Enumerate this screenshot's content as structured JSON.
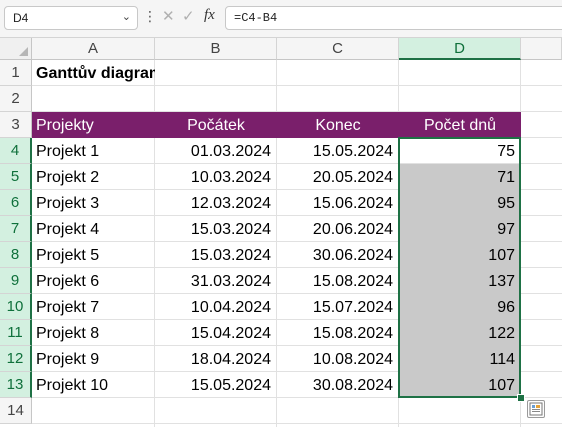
{
  "formula_bar": {
    "name_box": "D4",
    "formula": "=C4-B4",
    "more_icon": "vertical-ellipsis",
    "cancel_icon": "x-mark",
    "enter_icon": "check-mark",
    "fx_label": "fx"
  },
  "columns": [
    "A",
    "B",
    "C",
    "D"
  ],
  "rows": [
    "1",
    "2",
    "3",
    "4",
    "5",
    "6",
    "7",
    "8",
    "9",
    "10",
    "11",
    "12",
    "13",
    "14"
  ],
  "sheet": {
    "title": "Ganttův diagram",
    "headers": [
      "Projekty",
      "Počátek",
      "Konec",
      "Počet dnů"
    ],
    "data": [
      [
        "Projekt 1",
        "01.03.2024",
        "15.05.2024",
        "75"
      ],
      [
        "Projekt 2",
        "10.03.2024",
        "20.05.2024",
        "71"
      ],
      [
        "Projekt 3",
        "12.03.2024",
        "15.06.2024",
        "95"
      ],
      [
        "Projekt 4",
        "15.03.2024",
        "20.06.2024",
        "97"
      ],
      [
        "Projekt 5",
        "15.03.2024",
        "30.06.2024",
        "107"
      ],
      [
        "Projekt 6",
        "31.03.2024",
        "15.08.2024",
        "137"
      ],
      [
        "Projekt 7",
        "10.04.2024",
        "15.07.2024",
        "96"
      ],
      [
        "Projekt 8",
        "15.04.2024",
        "15.08.2024",
        "122"
      ],
      [
        "Projekt 9",
        "18.04.2024",
        "10.08.2024",
        "114"
      ],
      [
        "Projekt 10",
        "15.05.2024",
        "30.08.2024",
        "107"
      ]
    ]
  },
  "colors": {
    "header_fill": "#7a1f6b",
    "selection_border": "#1e7145",
    "selection_fill": "#c9c9c9"
  },
  "quick_analysis_icon": "quick-analysis-icon"
}
